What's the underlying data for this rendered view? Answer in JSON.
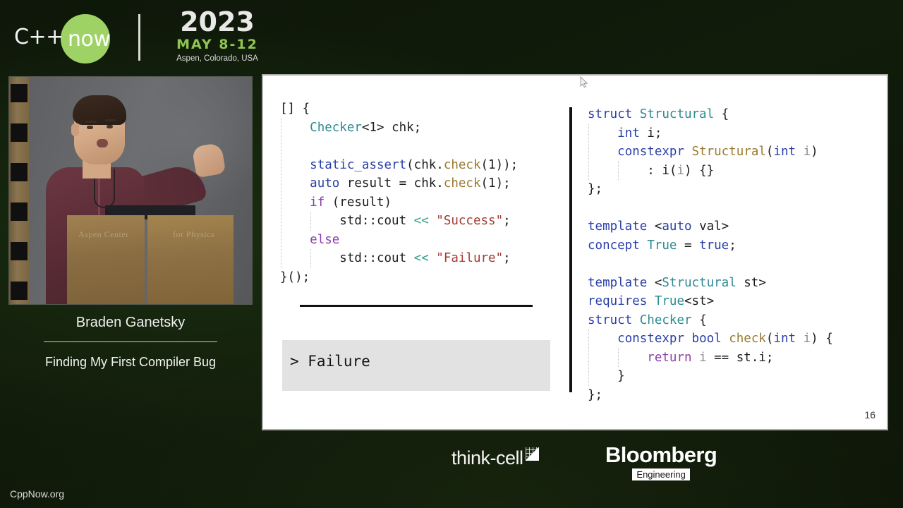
{
  "header": {
    "logo_cpp": "C++",
    "logo_now": "now",
    "year": "2023",
    "dates": "MAY 8-12",
    "location": "Aspen, Colorado, USA",
    "accent_green": "#9fd265",
    "dates_green": "#8fc752"
  },
  "video": {
    "podium_text_left": "Aspen Center",
    "podium_text_right": "for Physics"
  },
  "speaker": {
    "name": "Braden Ganetsky",
    "talk_title": "Finding My First Compiler Bug"
  },
  "slide": {
    "number": "16",
    "console_output": "> Failure",
    "code_left": [
      {
        "indent": 0,
        "tokens": [
          {
            "t": "[] {",
            "c": "pln"
          }
        ]
      },
      {
        "indent": 1,
        "tokens": [
          {
            "t": "Checker",
            "c": "typ"
          },
          {
            "t": "<1> chk;",
            "c": "pln"
          }
        ]
      },
      {
        "indent": 1,
        "tokens": []
      },
      {
        "indent": 1,
        "tokens": [
          {
            "t": "static_assert",
            "c": "kw"
          },
          {
            "t": "(chk.",
            "c": "pln"
          },
          {
            "t": "check",
            "c": "fn"
          },
          {
            "t": "(1));",
            "c": "pln"
          }
        ]
      },
      {
        "indent": 1,
        "tokens": [
          {
            "t": "auto",
            "c": "kw"
          },
          {
            "t": " result = chk.",
            "c": "pln"
          },
          {
            "t": "check",
            "c": "fn"
          },
          {
            "t": "(1);",
            "c": "pln"
          }
        ]
      },
      {
        "indent": 1,
        "tokens": [
          {
            "t": "if",
            "c": "ctl"
          },
          {
            "t": " (result)",
            "c": "pln"
          }
        ]
      },
      {
        "indent": 2,
        "tokens": [
          {
            "t": "std::cout ",
            "c": "pln"
          },
          {
            "t": "<<",
            "c": "op"
          },
          {
            "t": " ",
            "c": "pln"
          },
          {
            "t": "\"Success\"",
            "c": "str"
          },
          {
            "t": ";",
            "c": "pln"
          }
        ]
      },
      {
        "indent": 1,
        "tokens": [
          {
            "t": "else",
            "c": "ctl"
          }
        ]
      },
      {
        "indent": 2,
        "tokens": [
          {
            "t": "std::cout ",
            "c": "pln"
          },
          {
            "t": "<<",
            "c": "op"
          },
          {
            "t": " ",
            "c": "pln"
          },
          {
            "t": "\"Failure\"",
            "c": "str"
          },
          {
            "t": ";",
            "c": "pln"
          }
        ]
      },
      {
        "indent": 0,
        "tokens": [
          {
            "t": "}();",
            "c": "pln"
          }
        ]
      }
    ],
    "code_right": [
      {
        "indent": 0,
        "tokens": [
          {
            "t": "struct",
            "c": "kw"
          },
          {
            "t": " ",
            "c": "pln"
          },
          {
            "t": "Structural",
            "c": "typ"
          },
          {
            "t": " {",
            "c": "pln"
          }
        ]
      },
      {
        "indent": 1,
        "tokens": [
          {
            "t": "int",
            "c": "kw"
          },
          {
            "t": " i;",
            "c": "pln"
          }
        ]
      },
      {
        "indent": 1,
        "tokens": [
          {
            "t": "constexpr",
            "c": "kw"
          },
          {
            "t": " ",
            "c": "pln"
          },
          {
            "t": "Structural",
            "c": "fn"
          },
          {
            "t": "(",
            "c": "pln"
          },
          {
            "t": "int",
            "c": "kw"
          },
          {
            "t": " ",
            "c": "pln"
          },
          {
            "t": "i",
            "c": "var"
          },
          {
            "t": ")",
            "c": "pln"
          }
        ]
      },
      {
        "indent": 2,
        "tokens": [
          {
            "t": ": i(",
            "c": "pln"
          },
          {
            "t": "i",
            "c": "var"
          },
          {
            "t": ") {}",
            "c": "pln"
          }
        ]
      },
      {
        "indent": 0,
        "tokens": [
          {
            "t": "};",
            "c": "pln"
          }
        ]
      },
      {
        "indent": 0,
        "tokens": []
      },
      {
        "indent": 0,
        "tokens": [
          {
            "t": "template",
            "c": "kw"
          },
          {
            "t": " <",
            "c": "pln"
          },
          {
            "t": "auto",
            "c": "kw"
          },
          {
            "t": " val>",
            "c": "pln"
          }
        ]
      },
      {
        "indent": 0,
        "tokens": [
          {
            "t": "concept",
            "c": "kw"
          },
          {
            "t": " ",
            "c": "pln"
          },
          {
            "t": "True",
            "c": "typ"
          },
          {
            "t": " = ",
            "c": "pln"
          },
          {
            "t": "true",
            "c": "kw"
          },
          {
            "t": ";",
            "c": "pln"
          }
        ]
      },
      {
        "indent": 0,
        "tokens": []
      },
      {
        "indent": 0,
        "tokens": [
          {
            "t": "template",
            "c": "kw"
          },
          {
            "t": " <",
            "c": "pln"
          },
          {
            "t": "Structural",
            "c": "typ"
          },
          {
            "t": " st>",
            "c": "pln"
          }
        ]
      },
      {
        "indent": 0,
        "tokens": [
          {
            "t": "requires",
            "c": "kw"
          },
          {
            "t": " ",
            "c": "pln"
          },
          {
            "t": "True",
            "c": "typ"
          },
          {
            "t": "<st>",
            "c": "pln"
          }
        ]
      },
      {
        "indent": 0,
        "tokens": [
          {
            "t": "struct",
            "c": "kw"
          },
          {
            "t": " ",
            "c": "pln"
          },
          {
            "t": "Checker",
            "c": "typ"
          },
          {
            "t": " {",
            "c": "pln"
          }
        ]
      },
      {
        "indent": 1,
        "tokens": [
          {
            "t": "constexpr",
            "c": "kw"
          },
          {
            "t": " ",
            "c": "pln"
          },
          {
            "t": "bool",
            "c": "kw"
          },
          {
            "t": " ",
            "c": "pln"
          },
          {
            "t": "check",
            "c": "fn"
          },
          {
            "t": "(",
            "c": "pln"
          },
          {
            "t": "int",
            "c": "kw"
          },
          {
            "t": " ",
            "c": "pln"
          },
          {
            "t": "i",
            "c": "var"
          },
          {
            "t": ") {",
            "c": "pln"
          }
        ]
      },
      {
        "indent": 2,
        "tokens": [
          {
            "t": "return",
            "c": "ctl"
          },
          {
            "t": " ",
            "c": "pln"
          },
          {
            "t": "i",
            "c": "var"
          },
          {
            "t": " == st.i;",
            "c": "pln"
          }
        ]
      },
      {
        "indent": 1,
        "tokens": [
          {
            "t": "}",
            "c": "pln"
          }
        ]
      },
      {
        "indent": 0,
        "tokens": [
          {
            "t": "};",
            "c": "pln"
          }
        ]
      }
    ]
  },
  "sponsors": {
    "thinkcell": "think-cell",
    "bloomberg_name": "Bloomberg",
    "bloomberg_sub": "Engineering"
  },
  "footer": {
    "watermark": "CppNow.org"
  }
}
